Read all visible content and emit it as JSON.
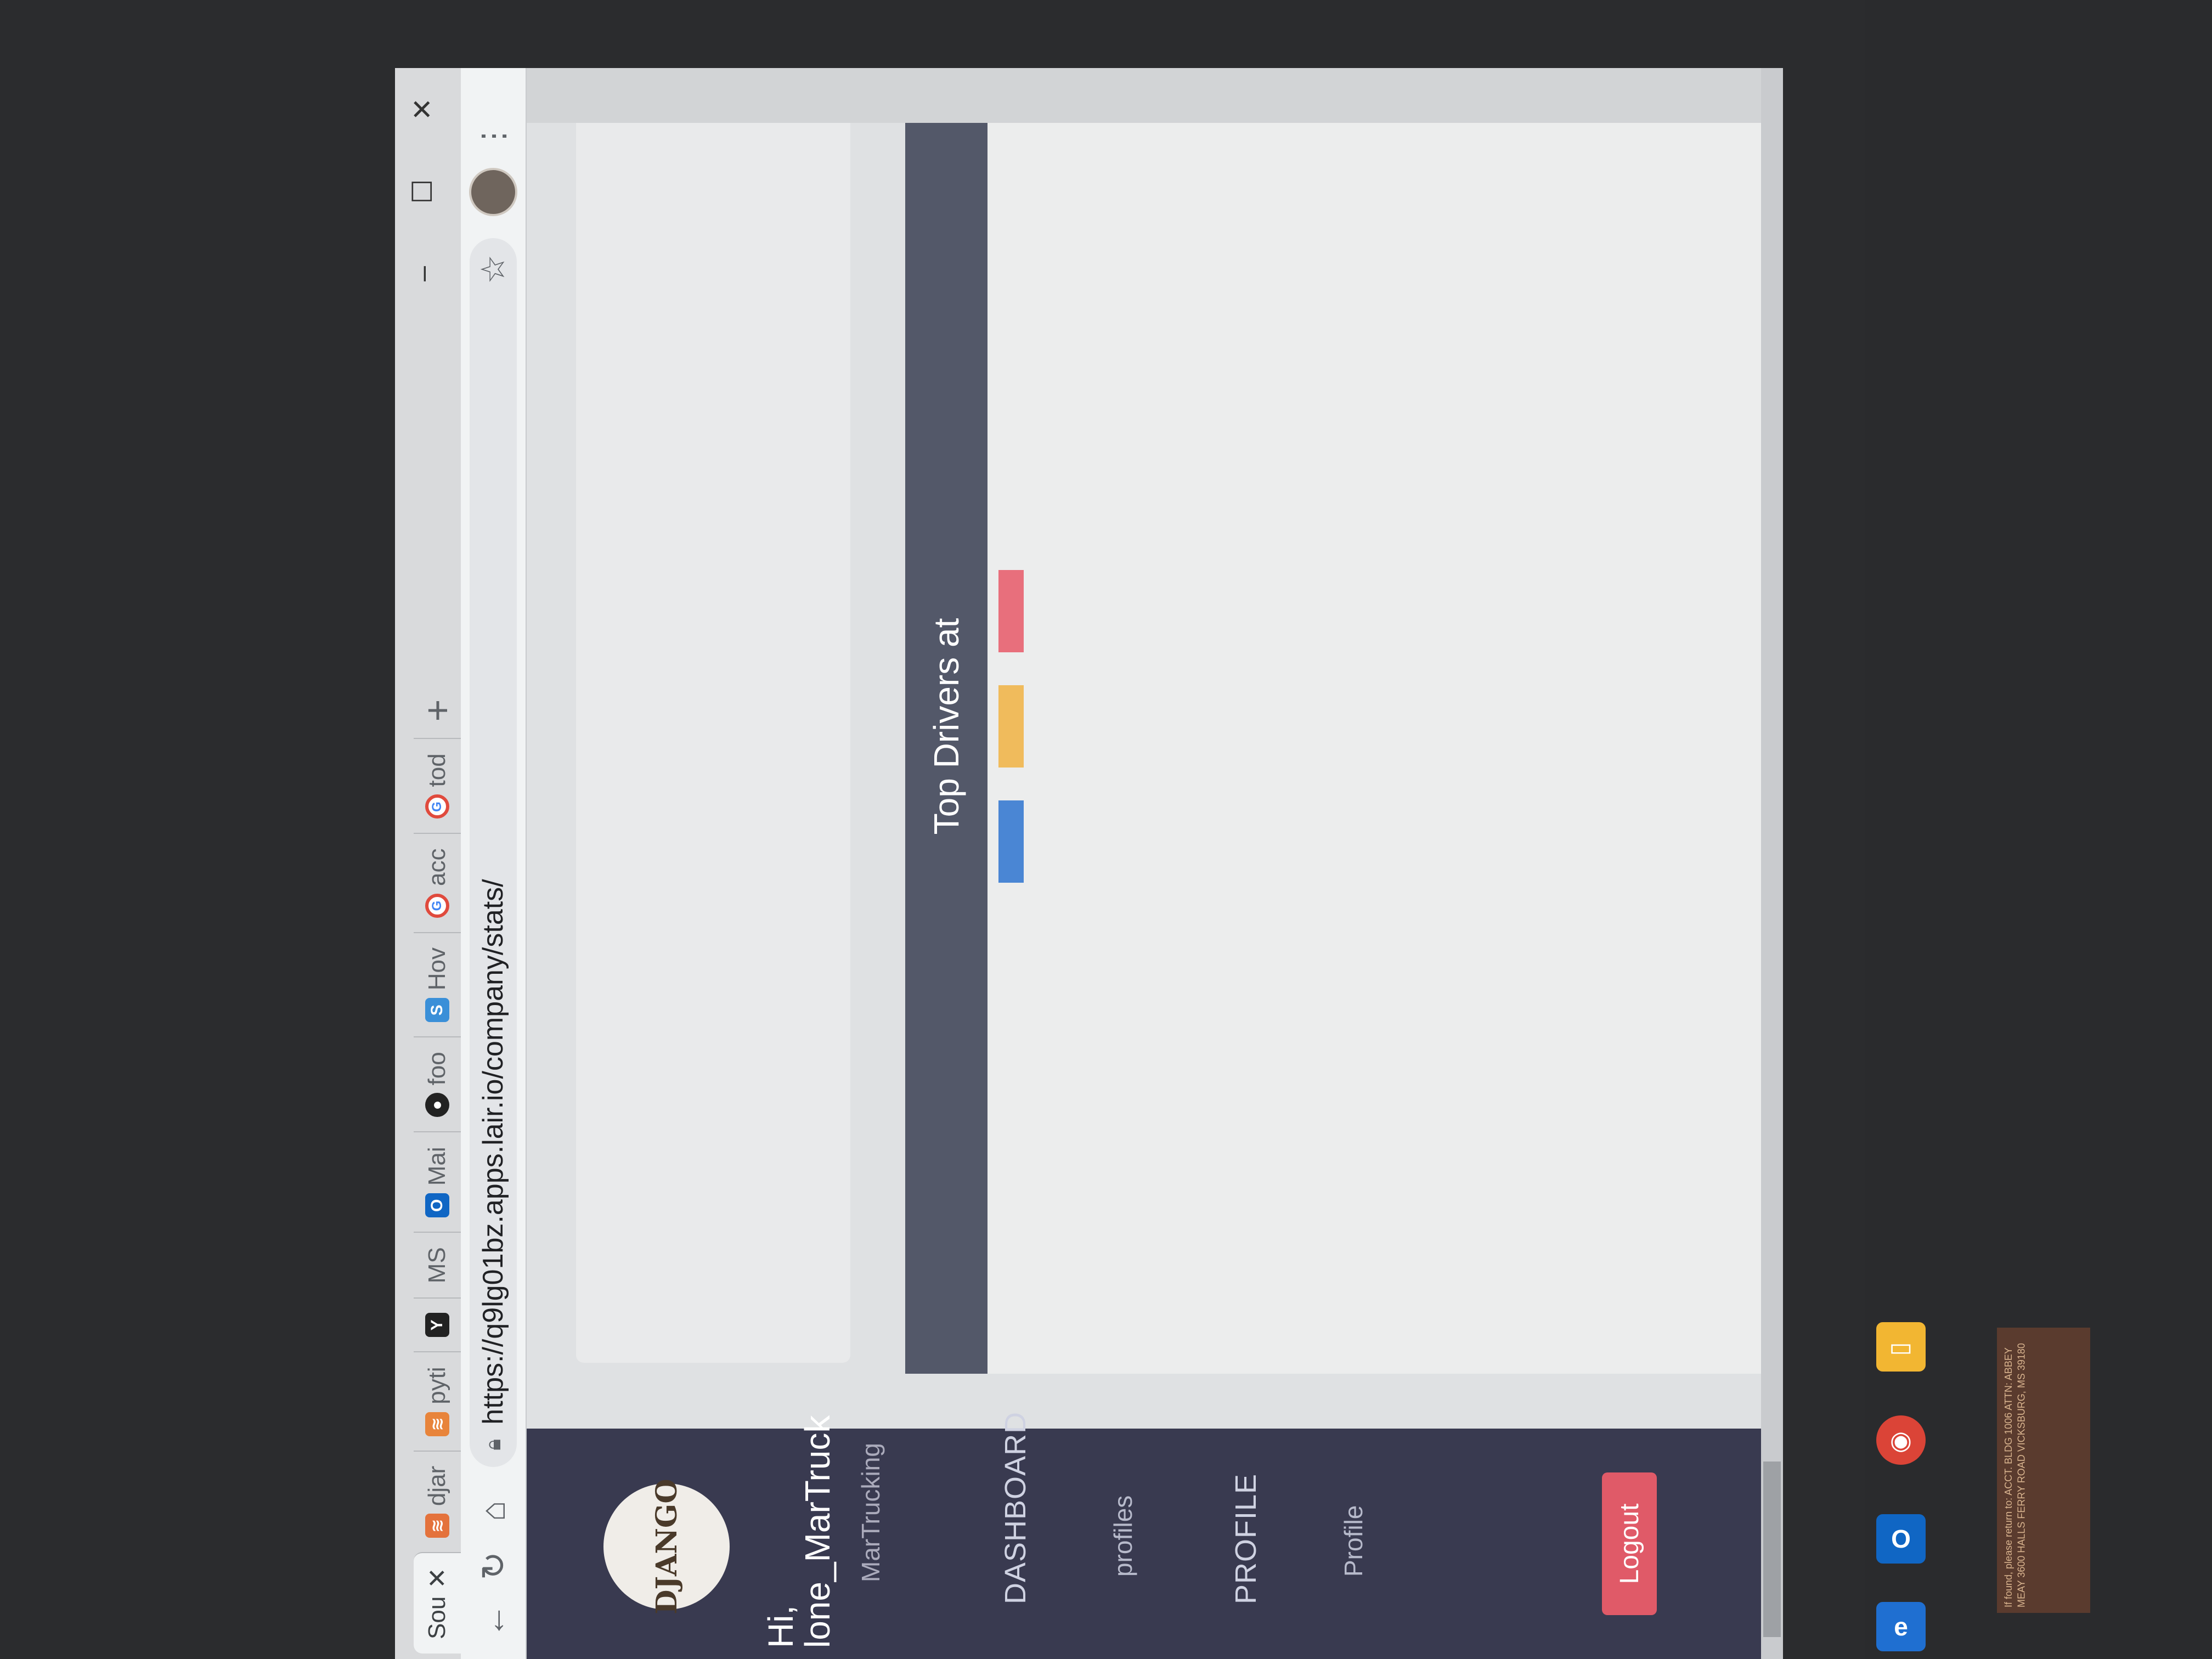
{
  "browser": {
    "tabs": [
      {
        "label": "Sou",
        "icon": "page-icon",
        "active": true
      },
      {
        "label": "djar",
        "icon": "django-icon"
      },
      {
        "label": "pyti",
        "icon": "python-icon"
      },
      {
        "label": "",
        "icon": "y-icon"
      },
      {
        "label": "MS",
        "icon": "ms-icon"
      },
      {
        "label": "Mai",
        "icon": "outlook-icon"
      },
      {
        "label": "foo",
        "icon": "github-icon"
      },
      {
        "label": "Hov",
        "icon": "s-icon"
      },
      {
        "label": "acc",
        "icon": "google-icon"
      },
      {
        "label": "tod",
        "icon": "google-icon"
      }
    ],
    "new_tab": "+",
    "url": "https://q9lg01bz.apps.lair.io/company/stats/",
    "window_controls": {
      "minimize": "–",
      "maximize": "☐",
      "close": "✕"
    }
  },
  "sidebar": {
    "logo_text": "DJANGO",
    "greeting": "Hi,",
    "username": "lone_MarTruck",
    "company": "MarTrucking",
    "nav": [
      {
        "heading": "DASHBOARD",
        "item": "profiles"
      },
      {
        "heading": "PROFILE",
        "item": "Profile"
      }
    ],
    "logout_label": "Logout"
  },
  "chart_card": {
    "title": "Top Drivers at",
    "legend_colors": [
      "#4a86d4",
      "#f0bb5c",
      "#e86f7c"
    ]
  },
  "taskbar": {
    "icons": [
      "edge-icon",
      "outlook-icon",
      "chrome-icon",
      "file-explorer-icon"
    ]
  },
  "sticky_note": "If found, please return to: ACCT. BLDG 1006 ATTN: ABBEY MEAY 3600 HALLS FERRY ROAD VICKSBURG, MS 39180"
}
